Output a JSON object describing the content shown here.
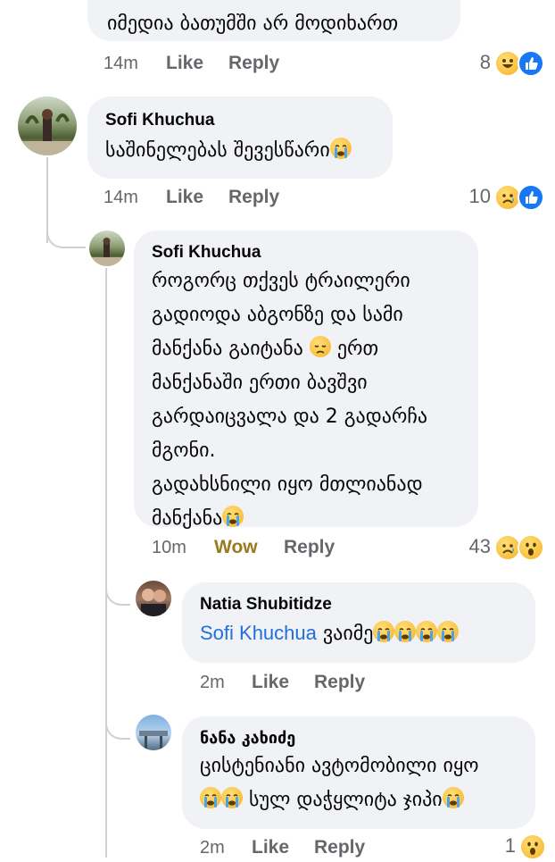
{
  "comments": [
    {
      "text": "იმედია ბათუმში არ მოდიხართ",
      "time": "14m",
      "like": "Like",
      "reply": "Reply",
      "reaction_count": "8",
      "reactions": [
        "haha-icon",
        "like-icon"
      ]
    },
    {
      "author": "Sofi Khuchua",
      "text": "საშინელებას შევესწარი",
      "time": "14m",
      "like": "Like",
      "reply": "Reply",
      "reaction_count": "10",
      "reactions": [
        "sad-icon",
        "like-icon"
      ]
    },
    {
      "author": "Sofi Khuchua",
      "lines": [
        "როგორც თქვეს ტრაილერი",
        "გადიოდა აბგონზე და სამი",
        "მანქანა გაიტანა",
        "მანქანაში ერთი ბავშვი",
        "გარდაიცვალა და 2 გადარჩა",
        "მგონი.",
        "გადახსნილი იყო მთლიანად",
        "მანქანა"
      ],
      "line3_tail": "ერთ",
      "time": "10m",
      "like": "Wow",
      "reply": "Reply",
      "reaction_count": "43",
      "reactions": [
        "sad-icon",
        "wow-icon"
      ]
    },
    {
      "author": "Natia Shubitidze",
      "mention": "Sofi Khuchua",
      "text": "ვაიმე",
      "time": "2m",
      "like": "Like",
      "reply": "Reply"
    },
    {
      "author": "ნანა კახიძე",
      "lines": [
        "ცისტენიანი ავტომობილი იყო",
        "სულ დაჭყლიტა ჯიპი"
      ],
      "time": "2m",
      "like": "Like",
      "reply": "Reply",
      "reaction_count": "1",
      "reactions": [
        "wow-icon"
      ]
    }
  ],
  "colors": {
    "bubble": "#f0f2f5",
    "meta": "#65676b",
    "mention": "#216fdb",
    "wow": "#9a7a1c",
    "like_blue": "#1877f2"
  }
}
